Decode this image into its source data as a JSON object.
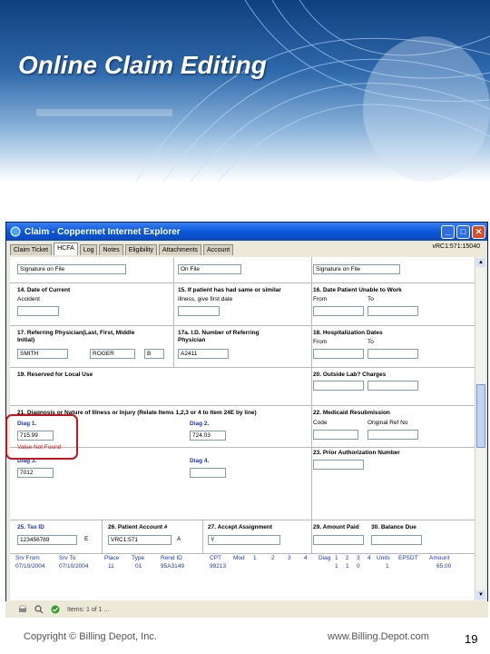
{
  "slide": {
    "title": "Online Claim Editing",
    "footer_left": "Copyright © Billing Depot, Inc.",
    "footer_right": "www.Billing.Depot.com",
    "page_number": "19"
  },
  "window": {
    "title": "Claim - Coppermet Internet Explorer",
    "claim_ref": "vRC1:571:15040",
    "tabs": [
      "Claim Ticket",
      "HCFA",
      "Log",
      "Notes",
      "Eligibility",
      "Attachments",
      "Account"
    ],
    "active_tab": "HCFA"
  },
  "form": {
    "top": {
      "sig_patient": "Signature on File",
      "date_value": "On File",
      "sig_insured": "Signature on File"
    },
    "box14": {
      "label": "14. Date of Current",
      "sub": "Accident"
    },
    "box15": {
      "label": "15. If patient has had same or similar",
      "sub": "illness, give first date"
    },
    "box16": {
      "label": "16. Date Patient Unable to Work",
      "from": "From",
      "to": "To"
    },
    "box17": {
      "label": "17. Referring Physician(Last, First, Middle",
      "sub": "Initial)",
      "last": "SMITH",
      "first": "ROGER",
      "middle": "B"
    },
    "box17a": {
      "label": "17a. I.D. Number of Referring",
      "sub": "Physician",
      "value": "A2411"
    },
    "box18": {
      "label": "18. Hospitalization Dates",
      "from": "From",
      "to": "To"
    },
    "box19": {
      "label": "19. Reserved for Local Use"
    },
    "box20": {
      "label": "20. Outside Lab? Charges"
    },
    "box21": {
      "label": "21. Diagnosis or Nature of Illness or Injury (Relate Items 1,2,3 or 4 to Item 24E by line)",
      "diag1_label": "Diag 1.",
      "diag1_value": "715.99",
      "diag2_label": "Diag 2.",
      "diag2_value": "724.03",
      "diag1_error": "Value Not Found",
      "diag3_label": "Diag 3.",
      "diag3_value": "7012",
      "diag4_label": "Diag 4."
    },
    "box22": {
      "label": "22. Medicaid Resubmission",
      "code": "Code",
      "orig": "Original Ref No"
    },
    "box23": {
      "label": "23. Prior Authorization Number"
    },
    "box25": {
      "label": "25. Tax ID",
      "value": "123456789",
      "type": "E"
    },
    "box26": {
      "label": "26. Patient Account #",
      "value": "VRC1:571",
      "type": "A"
    },
    "box27": {
      "label": "27. Accept Assignment",
      "value": "Y"
    },
    "box29": {
      "label": "29. Amount Paid",
      "label2": "30. Balance Due"
    },
    "services": {
      "headers": [
        "Srv From",
        "Srv To",
        "Place",
        "Type",
        "Rend ID",
        "CPT",
        "Mod",
        "1",
        "2",
        "3",
        "4",
        "Diag",
        "1",
        "2",
        "3",
        "4",
        "Units",
        "EPSDT",
        "Amount"
      ],
      "row": [
        "07/10/2004",
        "07/10/2004",
        "11",
        "01",
        "95A3149",
        "99213",
        "",
        "",
        "",
        "",
        "",
        "",
        "1",
        "1",
        "0",
        "",
        "1",
        "",
        "65.00"
      ]
    }
  },
  "statusbar": {
    "text": "Items: 1 of 1 ..."
  }
}
